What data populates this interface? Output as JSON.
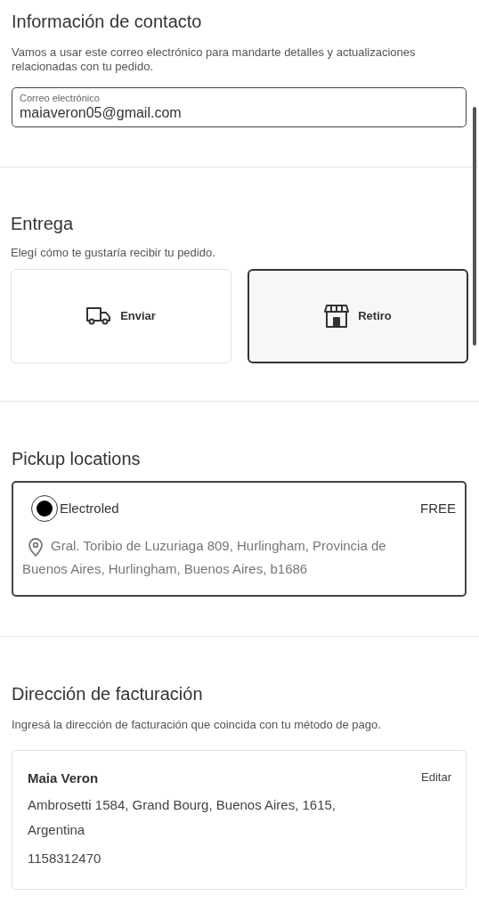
{
  "contact": {
    "title": "Información de contacto",
    "description": "Vamos a usar este correo electrónico para mandarte detalles y actualizaciones relacionadas con tu pedido.",
    "email_field": {
      "label": "Correo electrónico",
      "value": "maiaveron05@gmail.com"
    }
  },
  "delivery": {
    "title": "Entrega",
    "description": "Elegí cómo te gustaría recibir tu pedido.",
    "options": [
      {
        "kind": "ship",
        "label": "Enviar",
        "selected": false
      },
      {
        "kind": "pickup",
        "label": "Retiro",
        "selected": true
      }
    ]
  },
  "pickup": {
    "title": "Pickup locations",
    "locations": [
      {
        "name": "Electroled",
        "price": "FREE",
        "address": "Gral. Toribio de Luzuriaga 809, Hurlingham, Provincia de Buenos Aires, Hurlingham, Buenos Aires, b1686",
        "selected": true
      }
    ]
  },
  "billing": {
    "title": "Dirección de facturación",
    "description": "Ingresá la dirección de facturación que coincida con tu método de pago.",
    "address": {
      "name": "Maia Veron",
      "edit": "Editar",
      "lines": [
        "Ambrosetti 1584, Grand Bourg, Buenos Aires, 1615, Argentina",
        "1158312470"
      ]
    }
  }
}
